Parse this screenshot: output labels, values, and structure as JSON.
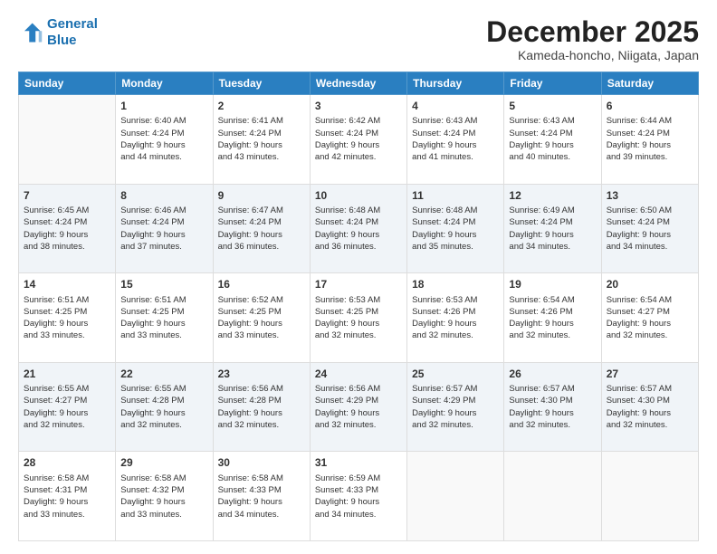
{
  "logo": {
    "line1": "General",
    "line2": "Blue"
  },
  "header": {
    "month": "December 2025",
    "location": "Kameda-honcho, Niigata, Japan"
  },
  "weekdays": [
    "Sunday",
    "Monday",
    "Tuesday",
    "Wednesday",
    "Thursday",
    "Friday",
    "Saturday"
  ],
  "weeks": [
    [
      {
        "day": "",
        "info": ""
      },
      {
        "day": "1",
        "info": "Sunrise: 6:40 AM\nSunset: 4:24 PM\nDaylight: 9 hours\nand 44 minutes."
      },
      {
        "day": "2",
        "info": "Sunrise: 6:41 AM\nSunset: 4:24 PM\nDaylight: 9 hours\nand 43 minutes."
      },
      {
        "day": "3",
        "info": "Sunrise: 6:42 AM\nSunset: 4:24 PM\nDaylight: 9 hours\nand 42 minutes."
      },
      {
        "day": "4",
        "info": "Sunrise: 6:43 AM\nSunset: 4:24 PM\nDaylight: 9 hours\nand 41 minutes."
      },
      {
        "day": "5",
        "info": "Sunrise: 6:43 AM\nSunset: 4:24 PM\nDaylight: 9 hours\nand 40 minutes."
      },
      {
        "day": "6",
        "info": "Sunrise: 6:44 AM\nSunset: 4:24 PM\nDaylight: 9 hours\nand 39 minutes."
      }
    ],
    [
      {
        "day": "7",
        "info": "Sunrise: 6:45 AM\nSunset: 4:24 PM\nDaylight: 9 hours\nand 38 minutes."
      },
      {
        "day": "8",
        "info": "Sunrise: 6:46 AM\nSunset: 4:24 PM\nDaylight: 9 hours\nand 37 minutes."
      },
      {
        "day": "9",
        "info": "Sunrise: 6:47 AM\nSunset: 4:24 PM\nDaylight: 9 hours\nand 36 minutes."
      },
      {
        "day": "10",
        "info": "Sunrise: 6:48 AM\nSunset: 4:24 PM\nDaylight: 9 hours\nand 36 minutes."
      },
      {
        "day": "11",
        "info": "Sunrise: 6:48 AM\nSunset: 4:24 PM\nDaylight: 9 hours\nand 35 minutes."
      },
      {
        "day": "12",
        "info": "Sunrise: 6:49 AM\nSunset: 4:24 PM\nDaylight: 9 hours\nand 34 minutes."
      },
      {
        "day": "13",
        "info": "Sunrise: 6:50 AM\nSunset: 4:24 PM\nDaylight: 9 hours\nand 34 minutes."
      }
    ],
    [
      {
        "day": "14",
        "info": "Sunrise: 6:51 AM\nSunset: 4:25 PM\nDaylight: 9 hours\nand 33 minutes."
      },
      {
        "day": "15",
        "info": "Sunrise: 6:51 AM\nSunset: 4:25 PM\nDaylight: 9 hours\nand 33 minutes."
      },
      {
        "day": "16",
        "info": "Sunrise: 6:52 AM\nSunset: 4:25 PM\nDaylight: 9 hours\nand 33 minutes."
      },
      {
        "day": "17",
        "info": "Sunrise: 6:53 AM\nSunset: 4:25 PM\nDaylight: 9 hours\nand 32 minutes."
      },
      {
        "day": "18",
        "info": "Sunrise: 6:53 AM\nSunset: 4:26 PM\nDaylight: 9 hours\nand 32 minutes."
      },
      {
        "day": "19",
        "info": "Sunrise: 6:54 AM\nSunset: 4:26 PM\nDaylight: 9 hours\nand 32 minutes."
      },
      {
        "day": "20",
        "info": "Sunrise: 6:54 AM\nSunset: 4:27 PM\nDaylight: 9 hours\nand 32 minutes."
      }
    ],
    [
      {
        "day": "21",
        "info": "Sunrise: 6:55 AM\nSunset: 4:27 PM\nDaylight: 9 hours\nand 32 minutes."
      },
      {
        "day": "22",
        "info": "Sunrise: 6:55 AM\nSunset: 4:28 PM\nDaylight: 9 hours\nand 32 minutes."
      },
      {
        "day": "23",
        "info": "Sunrise: 6:56 AM\nSunset: 4:28 PM\nDaylight: 9 hours\nand 32 minutes."
      },
      {
        "day": "24",
        "info": "Sunrise: 6:56 AM\nSunset: 4:29 PM\nDaylight: 9 hours\nand 32 minutes."
      },
      {
        "day": "25",
        "info": "Sunrise: 6:57 AM\nSunset: 4:29 PM\nDaylight: 9 hours\nand 32 minutes."
      },
      {
        "day": "26",
        "info": "Sunrise: 6:57 AM\nSunset: 4:30 PM\nDaylight: 9 hours\nand 32 minutes."
      },
      {
        "day": "27",
        "info": "Sunrise: 6:57 AM\nSunset: 4:30 PM\nDaylight: 9 hours\nand 32 minutes."
      }
    ],
    [
      {
        "day": "28",
        "info": "Sunrise: 6:58 AM\nSunset: 4:31 PM\nDaylight: 9 hours\nand 33 minutes."
      },
      {
        "day": "29",
        "info": "Sunrise: 6:58 AM\nSunset: 4:32 PM\nDaylight: 9 hours\nand 33 minutes."
      },
      {
        "day": "30",
        "info": "Sunrise: 6:58 AM\nSunset: 4:33 PM\nDaylight: 9 hours\nand 34 minutes."
      },
      {
        "day": "31",
        "info": "Sunrise: 6:59 AM\nSunset: 4:33 PM\nDaylight: 9 hours\nand 34 minutes."
      },
      {
        "day": "",
        "info": ""
      },
      {
        "day": "",
        "info": ""
      },
      {
        "day": "",
        "info": ""
      }
    ]
  ]
}
